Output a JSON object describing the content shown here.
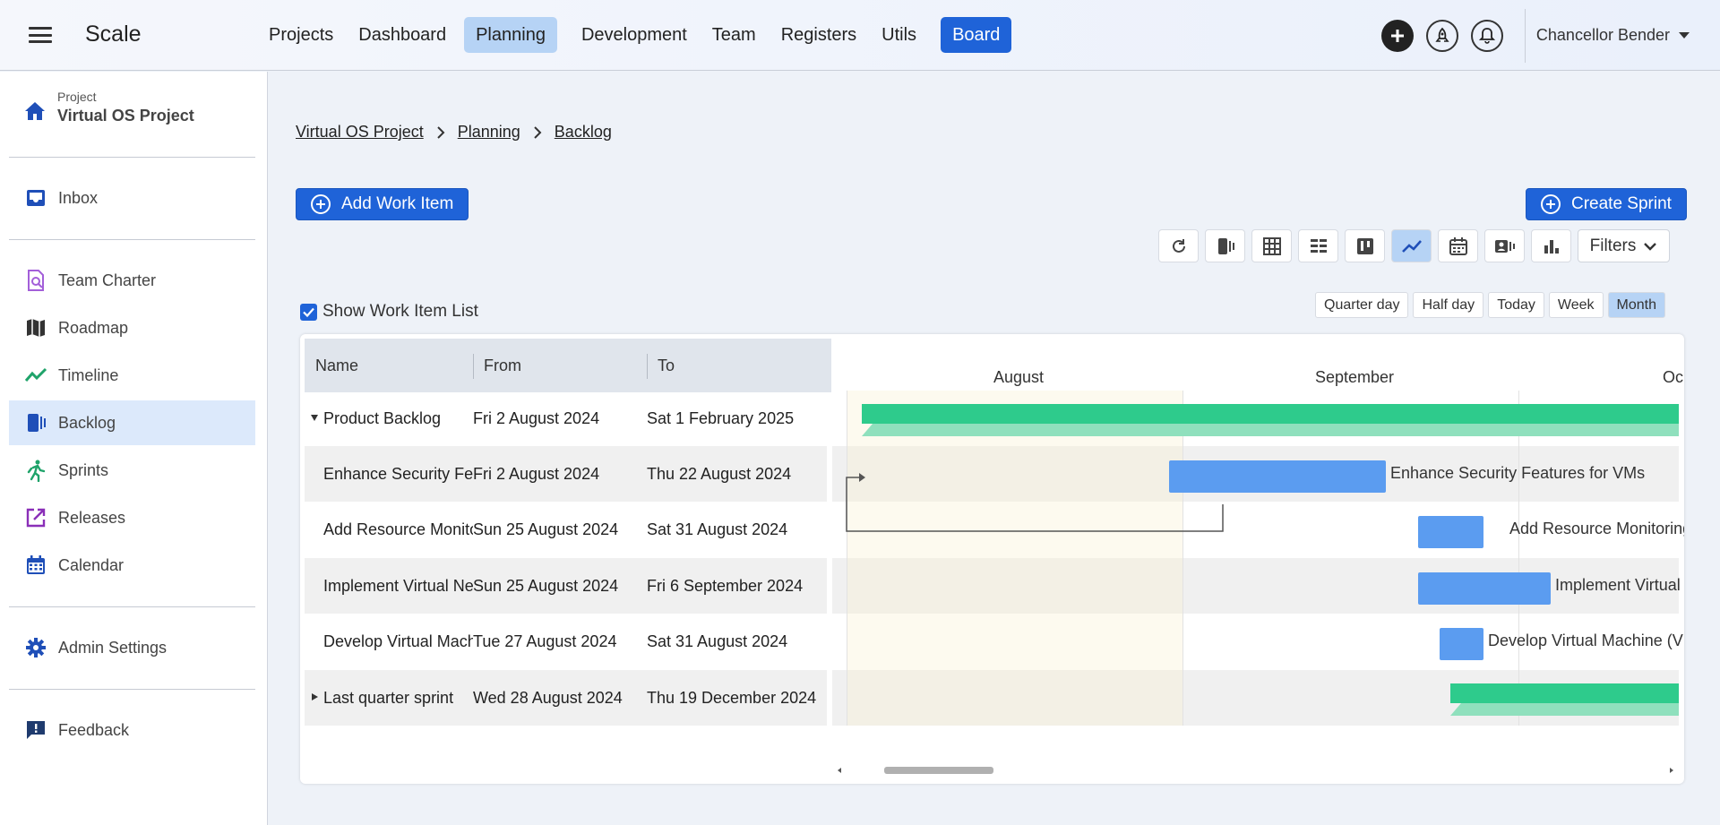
{
  "app": {
    "title": "Scale"
  },
  "nav": {
    "items": [
      "Projects",
      "Dashboard",
      "Planning",
      "Development",
      "Team",
      "Registers",
      "Utils"
    ],
    "board_label": "Board",
    "active": "Planning"
  },
  "user": {
    "name": "Chancellor Bender"
  },
  "sidebar": {
    "project_caption": "Project",
    "project_name": "Virtual OS Project",
    "inbox": "Inbox",
    "team_charter": "Team Charter",
    "roadmap": "Roadmap",
    "timeline": "Timeline",
    "backlog": "Backlog",
    "sprints": "Sprints",
    "releases": "Releases",
    "calendar": "Calendar",
    "admin_settings": "Admin Settings",
    "feedback": "Feedback",
    "active": "Backlog"
  },
  "breadcrumb": [
    "Virtual OS Project",
    "Planning",
    "Backlog"
  ],
  "actions": {
    "add_work_item": "Add Work Item",
    "create_sprint": "Create Sprint",
    "filters": "Filters"
  },
  "toolbar": {
    "icons": [
      "refresh-icon",
      "backlog-view-icon",
      "table-view-icon",
      "list-view-icon",
      "kanban-view-icon",
      "timeline-view-icon",
      "calendar-view-icon",
      "card-view-icon",
      "chart-view-icon"
    ],
    "active": "timeline-view-icon"
  },
  "show_list": {
    "label": "Show Work Item List",
    "checked": true
  },
  "zoom": {
    "options": [
      "Quarter day",
      "Half day",
      "Today",
      "Week",
      "Month"
    ],
    "active": "Month"
  },
  "gantt": {
    "columns": [
      "Name",
      "From",
      "To"
    ],
    "rows": [
      {
        "name": "Product Backlog",
        "from": "Fri 2 August 2024",
        "to": "Sat 1 February 2025",
        "type": "sprint",
        "expanded": true
      },
      {
        "name": "Enhance Security Features for VMs",
        "from": "Fri 2 August 2024",
        "to": "Thu 22 August 2024",
        "type": "task"
      },
      {
        "name": "Add Resource Monitoring and Alerts",
        "from": "Sun 25 August 2024",
        "to": "Sat 31 August 2024",
        "type": "task"
      },
      {
        "name": "Implement Virtual Network Configuration",
        "from": "Sun 25 August 2024",
        "to": "Fri 6 September 2024",
        "type": "task"
      },
      {
        "name": "Develop Virtual Machine (VM) Management Interface",
        "from": "Tue 27 August 2024",
        "to": "Sat 31 August 2024",
        "type": "task"
      },
      {
        "name": "Last quarter sprint",
        "from": "Wed 28 August 2024",
        "to": "Thu 19 December 2024",
        "type": "sprint",
        "expanded": false
      }
    ],
    "months": [
      "August",
      "September",
      "Oc"
    ]
  }
}
